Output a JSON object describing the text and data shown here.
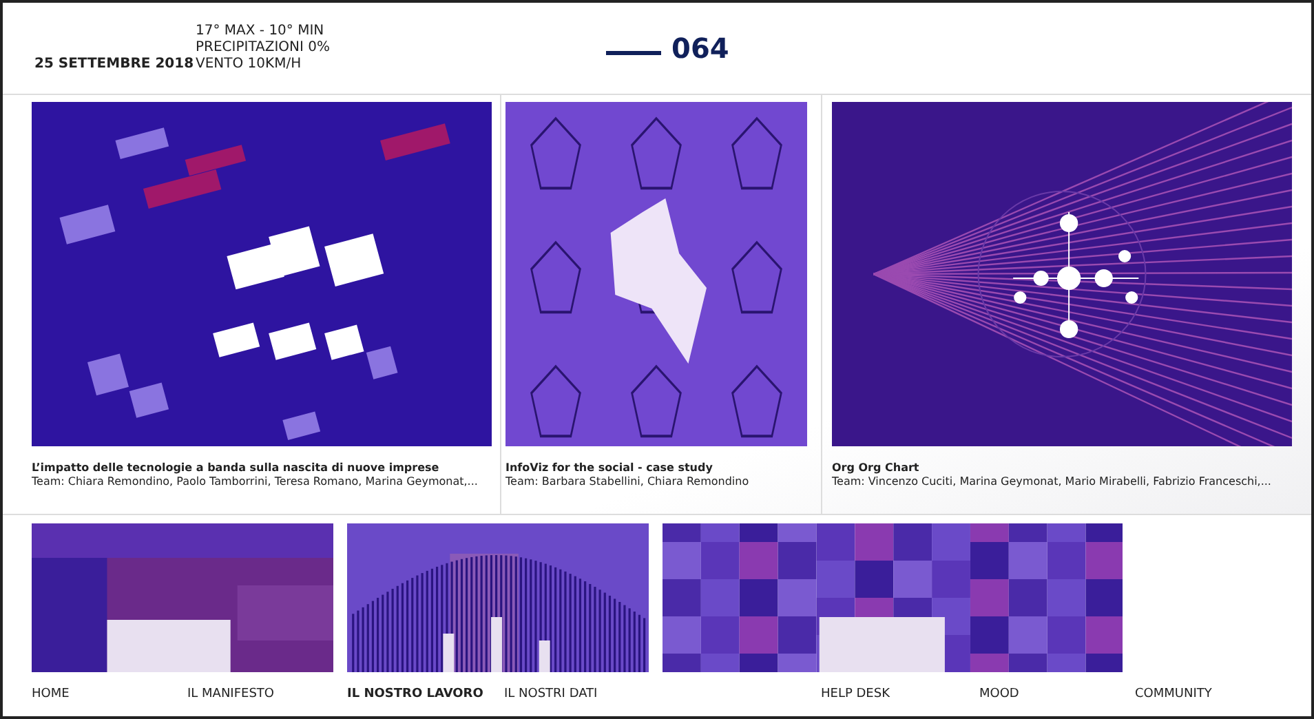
{
  "header": {
    "date": "25 SETTEMBRE 2018",
    "weather": [
      "17° MAX - 10° MIN",
      "PRECIPITAZIONI 0%",
      "VENTO 10KM/H"
    ],
    "number": "064"
  },
  "projects": [
    {
      "kind": "blocks",
      "title": "L’impatto delle tecnologie a banda sulla nascita di nuove imprese",
      "team": "Team: Chiara Remondino, Paolo Tamborrini, Teresa Romano, Marina Geymonat,..."
    },
    {
      "kind": "radar",
      "title": "InfoViz for the social - case study",
      "team": "Team: Barbara Stabellini, Chiara Remondino"
    },
    {
      "kind": "orgchart",
      "title": "Org Org Chart",
      "team": "Team: Vincenzo Cuciti, Marina Geymonat, Mario Mirabelli, Fabrizio Franceschi,..."
    }
  ],
  "previews": [
    {
      "kind": "treemap"
    },
    {
      "kind": "bars"
    },
    {
      "kind": "heatmap"
    }
  ],
  "nav": [
    {
      "label": "HOME",
      "selected": false
    },
    {
      "label": "IL MANIFESTO",
      "selected": false
    },
    {
      "label": "IL NOSTRO LAVORO",
      "selected": true
    },
    {
      "label": "IL NOSTRI DATI",
      "selected": false
    },
    {
      "label": "HELP DESK",
      "selected": false
    },
    {
      "label": "MOOD",
      "selected": false
    },
    {
      "label": "COMMUNITY",
      "selected": false
    }
  ]
}
